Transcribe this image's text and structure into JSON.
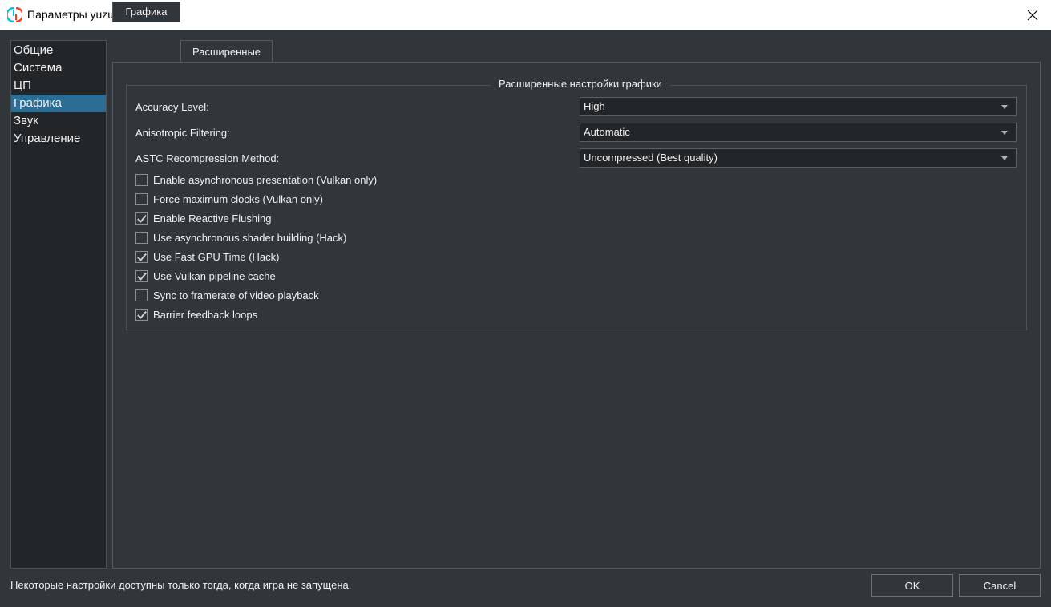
{
  "window": {
    "title": "Параметры yuzu"
  },
  "sidebar": {
    "items": [
      {
        "label": "Общие"
      },
      {
        "label": "Система"
      },
      {
        "label": "ЦП"
      },
      {
        "label": "Графика",
        "selected": true
      },
      {
        "label": "Звук"
      },
      {
        "label": "Управление"
      }
    ]
  },
  "tabs": [
    {
      "label": "Графика"
    },
    {
      "label": "Расширенные",
      "active": true
    }
  ],
  "group": {
    "title": "Расширенные настройки графики",
    "settings": [
      {
        "label": "Accuracy Level:",
        "value": "High"
      },
      {
        "label": "Anisotropic Filtering:",
        "value": "Automatic"
      },
      {
        "label": "ASTC Recompression Method:",
        "value": "Uncompressed (Best quality)"
      }
    ],
    "checkboxes": [
      {
        "label": "Enable asynchronous presentation (Vulkan only)",
        "checked": false
      },
      {
        "label": "Force maximum clocks (Vulkan only)",
        "checked": false
      },
      {
        "label": "Enable Reactive Flushing",
        "checked": true
      },
      {
        "label": "Use asynchronous shader building (Hack)",
        "checked": false
      },
      {
        "label": "Use Fast GPU Time (Hack)",
        "checked": true
      },
      {
        "label": "Use Vulkan pipeline cache",
        "checked": true
      },
      {
        "label": "Sync to framerate of video playback",
        "checked": false
      },
      {
        "label": "Barrier feedback loops",
        "checked": true
      }
    ]
  },
  "footer": {
    "status": "Некоторые настройки доступны только тогда, когда игра не запущена.",
    "ok_label": "OK",
    "cancel_label": "Cancel"
  },
  "colors": {
    "background": "#31363b",
    "selection": "#2c6d96"
  }
}
